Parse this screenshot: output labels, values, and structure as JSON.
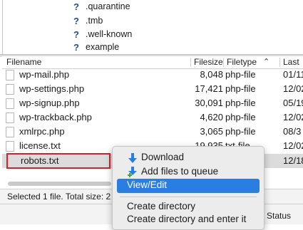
{
  "tree": {
    "items": [
      ".quarantine",
      ".tmb",
      ".well-known",
      "example"
    ]
  },
  "file_list": {
    "columns": [
      "Filename",
      "Filesize",
      "Filetype",
      "Last"
    ],
    "rows": [
      {
        "name": "wp-mail.php",
        "size": "8,048",
        "type": "php-file",
        "last": "01/11"
      },
      {
        "name": "wp-settings.php",
        "size": "17,421",
        "type": "php-file",
        "last": "12/02"
      },
      {
        "name": "wp-signup.php",
        "size": "30,091",
        "type": "php-file",
        "last": "05/19"
      },
      {
        "name": "wp-trackback.php",
        "size": "4,620",
        "type": "php-file",
        "last": "12/02"
      },
      {
        "name": "xmlrpc.php",
        "size": "3,065",
        "type": "php-file",
        "last": "08/3"
      },
      {
        "name": "license.txt",
        "size": "19,935",
        "type": "txt-file",
        "last": "12/02"
      },
      {
        "name": "robots.txt",
        "size": "",
        "type": "",
        "last": "12/18"
      }
    ]
  },
  "status_text": "Selected 1 file. Total size: 2",
  "queue_status_label": "Status",
  "context_menu": {
    "download": "Download",
    "add_to_queue": "Add files to queue",
    "view_edit": "View/Edit",
    "create_directory": "Create directory",
    "create_directory_enter": "Create directory and enter it"
  },
  "colors": {
    "highlight": "#2a7de1",
    "selection_box": "#d6202b"
  }
}
